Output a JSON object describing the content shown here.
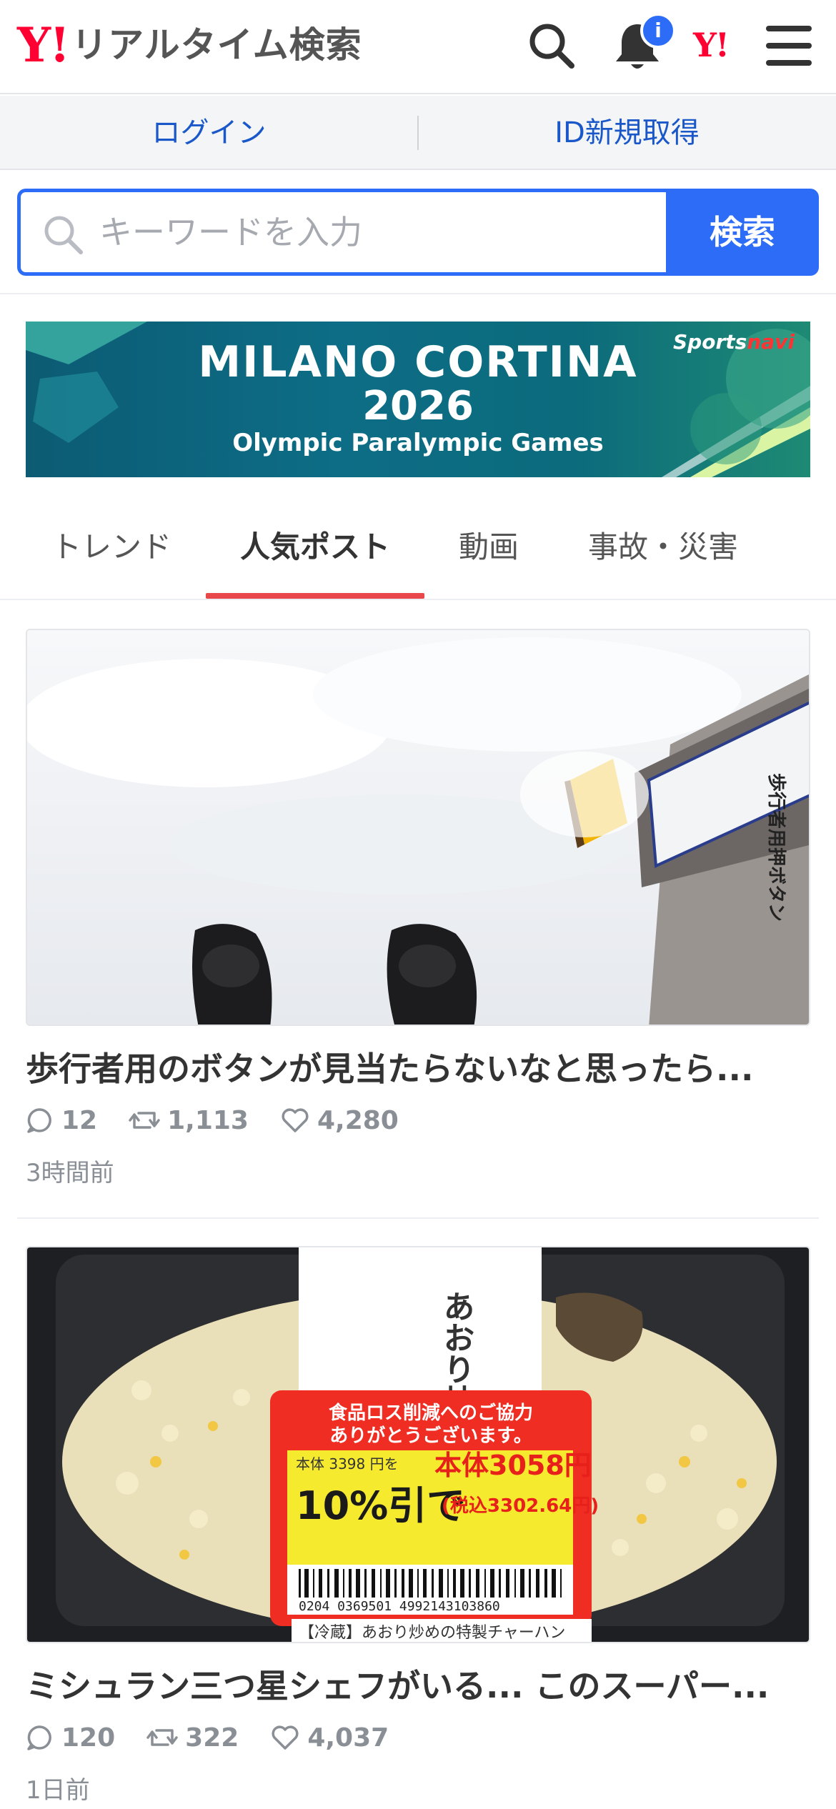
{
  "header": {
    "logo_mark": "Y!",
    "logo_text": "リアルタイム検索",
    "notification_badge": "i",
    "yj_mark": "Y!"
  },
  "loginbar": {
    "login": "ログイン",
    "register": "ID新規取得"
  },
  "search": {
    "placeholder": "キーワードを入力",
    "button": "検索"
  },
  "banner": {
    "title": "MILANO CORTINA",
    "year": "2026",
    "subtitle": "Olympic Paralympic Games",
    "brand_a": "Sports",
    "brand_b": "navi"
  },
  "tabs": [
    {
      "label": "トレンド"
    },
    {
      "label": "人気ポスト"
    },
    {
      "label": "動画"
    },
    {
      "label": "事故・災害"
    }
  ],
  "active_tab": 1,
  "posts": [
    {
      "title": "歩行者用のボタンが見当たらないなと思ったら...",
      "replies": "12",
      "reposts": "1,113",
      "likes": "4,280",
      "time": "3時間前",
      "image_sign_text": "歩行者用押ボタン"
    },
    {
      "title": "ミシュラン三つ星シェフがいる... このスーパー...",
      "replies": "120",
      "reposts": "322",
      "likes": "4,037",
      "time": "1日前",
      "label_product": "あおり炒め 特製チャーハン",
      "label_notice_1": "食品ロス削減へのご協力",
      "label_notice_2": "ありがとうございます。",
      "label_price_orig": "本体 3398 円を",
      "label_price_new": "本体3058円",
      "label_discount": "10%引で",
      "label_tax": "(税込3302.64円)",
      "label_barcode": "0204 0369501 4992143103860",
      "label_footer": "【冷蔵】あおり炒めの特製チャーハン"
    }
  ],
  "colors": {
    "accent": "#2c6cf6",
    "brand_red": "#ff0033",
    "tab_underline": "#e8484a",
    "link": "#1a57c9"
  }
}
